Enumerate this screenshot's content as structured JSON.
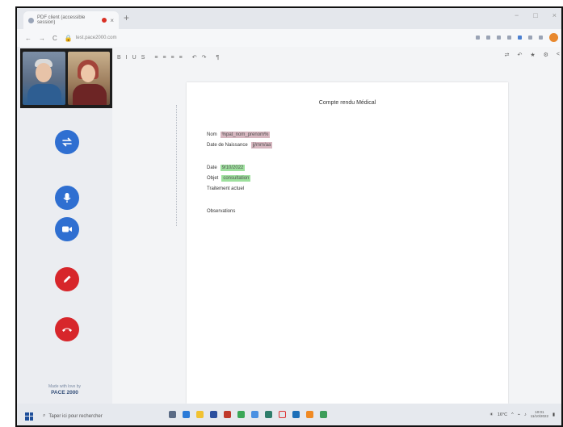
{
  "browser": {
    "tab_title": "PDF client (accessible session)",
    "new_tab": "+",
    "window_controls": [
      "−",
      "□",
      "×"
    ],
    "nav": {
      "back": "←",
      "forward": "→",
      "reload": "C"
    },
    "url": "test.pace2000.com"
  },
  "toolbar": {
    "format_buttons": [
      "B",
      "I",
      "U",
      "S"
    ],
    "list_buttons": [
      "≡",
      "≡",
      "≡",
      "≡"
    ],
    "undo": "↶",
    "redo": "↷",
    "extra": "¶",
    "right_icons": [
      "⇄",
      "↶",
      "★",
      "⚙",
      "<"
    ]
  },
  "document": {
    "title": "Compte rendu Médical",
    "fields": {
      "nom_label": "Nom",
      "nom_value": "%pat_nom_prenom%",
      "dob_label": "Date de Naissance",
      "dob_value": "jj/mm/aa",
      "date_label": "Date",
      "date_value": "9/10/2022",
      "objet_label": "Objet",
      "objet_value": "consultation",
      "treatment_label": "Traitement actuel",
      "obs_label": "Observations"
    }
  },
  "sidebar": {
    "brand_line1": "Made with love by",
    "brand_line2": "PACE 2000"
  },
  "taskbar": {
    "search_placeholder": "Taper ici pour rechercher",
    "weather": "16°C",
    "time": "10:01",
    "date": "11/10/2022"
  },
  "colors": {
    "accent_blue": "#2f6fd1",
    "accent_red": "#d7262b",
    "highlight_pink": "#d7b7c0",
    "highlight_green": "#9de09d"
  }
}
